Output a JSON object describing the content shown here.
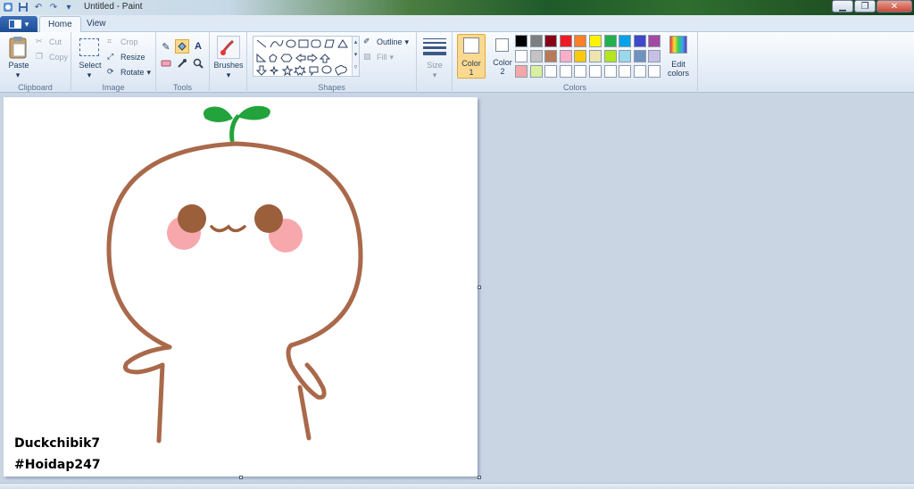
{
  "window": {
    "title": "Untitled - Paint"
  },
  "tabs": [
    "Home",
    "View"
  ],
  "ribbon": {
    "clipboard": {
      "label": "Clipboard",
      "paste": "Paste",
      "cut": "Cut",
      "copy": "Copy"
    },
    "image": {
      "label": "Image",
      "select": "Select",
      "crop": "Crop",
      "resize": "Resize",
      "rotate": "Rotate"
    },
    "tools": {
      "label": "Tools"
    },
    "brushes": {
      "label": "Brushes"
    },
    "shapes": {
      "label": "Shapes",
      "outline": "Outline",
      "fill": "Fill"
    },
    "size": {
      "label": "Size"
    },
    "colors": {
      "label": "Colors",
      "color1": "Color",
      "color1_num": "1",
      "color2": "Color",
      "color2_num": "2",
      "edit": "Edit",
      "edit2": "colors",
      "palette_row1": [
        "#000000",
        "#7f7f7f",
        "#880015",
        "#ed1c24",
        "#ff7f27",
        "#fff200",
        "#22b14c",
        "#00a2e8",
        "#3f48cc",
        "#a349a4"
      ],
      "palette_row2": [
        "#ffffff",
        "#c3c3c3",
        "#b97a57",
        "#ffaec9",
        "#ffc90e",
        "#efe4b0",
        "#b5e61d",
        "#99d9ea",
        "#7092be",
        "#c8bfe7"
      ],
      "palette_row3": [
        "#f4a7a7",
        "#d8f0a0",
        "#ffffff",
        "#ffffff",
        "#ffffff",
        "#ffffff",
        "#ffffff",
        "#ffffff",
        "#ffffff",
        "#ffffff"
      ]
    }
  },
  "canvas": {
    "caption_line1": "Duckchibik7",
    "caption_line2": "#Hoidap247",
    "colors": {
      "outline": "#a9694a",
      "sprout": "#22a33c",
      "cheek": "#f7a8ad",
      "eye": "#9c5f3b"
    }
  }
}
